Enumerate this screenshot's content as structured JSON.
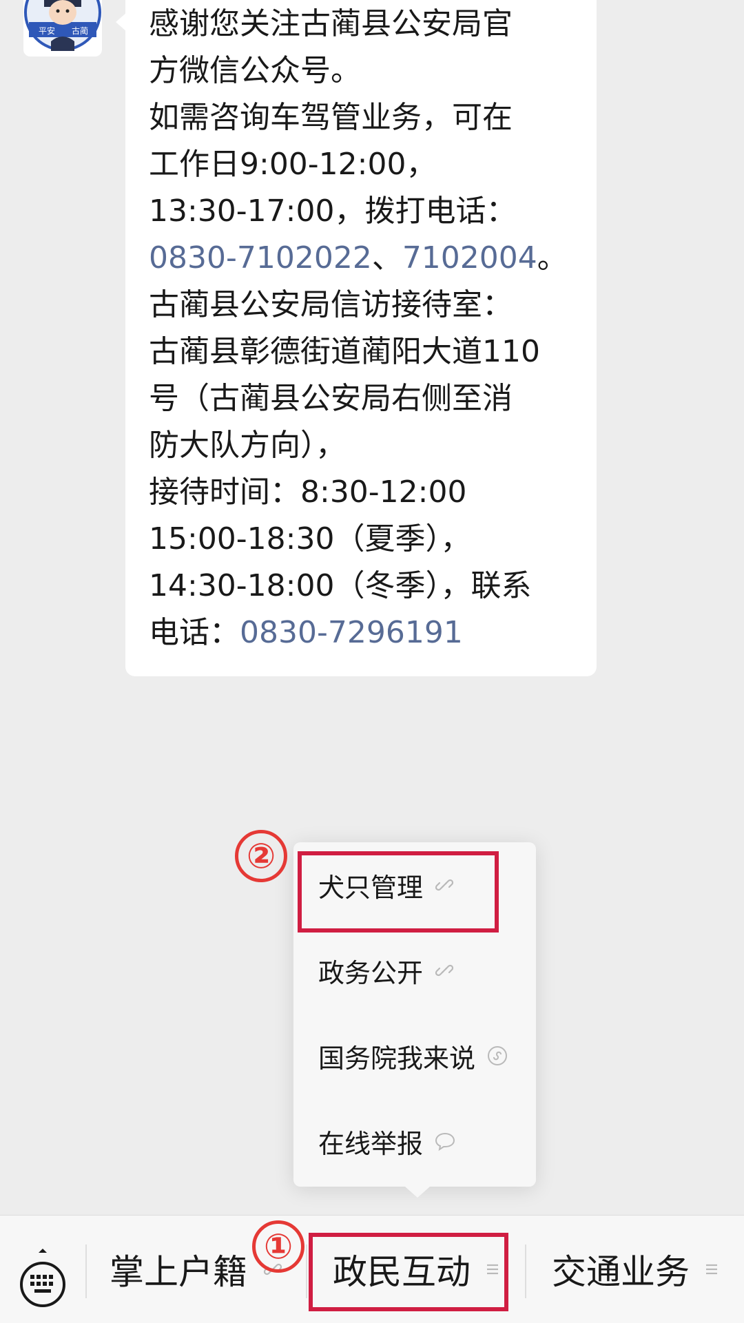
{
  "message": {
    "lines": [
      [
        {
          "text": "感谢您关注古蔺县公安局官",
          "link": false
        }
      ],
      [
        {
          "text": "方微信公众号。",
          "link": false
        }
      ],
      [
        {
          "text": "如需咨询车驾管业务，可在",
          "link": false
        }
      ],
      [
        {
          "text": "工作日9:00-12:00，",
          "link": false
        }
      ],
      [
        {
          "text": "13:30-17:00，拨打电话：",
          "link": false
        }
      ],
      [
        {
          "text": "0830-7102022",
          "link": true
        },
        {
          "text": "、",
          "link": false
        },
        {
          "text": "7102004",
          "link": true
        },
        {
          "text": "。",
          "link": false
        }
      ],
      [
        {
          "text": "古蔺县公安局信访接待室：",
          "link": false
        }
      ],
      [
        {
          "text": "古蔺县彰德街道蔺阳大道110",
          "link": false
        }
      ],
      [
        {
          "text": "号（古蔺县公安局右侧至消",
          "link": false
        }
      ],
      [
        {
          "text": "防大队方向），",
          "link": false
        }
      ],
      [
        {
          "text": "接待时间：8:30-12:00",
          "link": false
        }
      ],
      [
        {
          "text": "15:00-18:30（夏季），",
          "link": false
        }
      ],
      [
        {
          "text": "14:30-18:00（冬季），联系",
          "link": false
        }
      ],
      [
        {
          "text": "电话：",
          "link": false
        },
        {
          "text": "0830-7296191",
          "link": true
        }
      ]
    ]
  },
  "avatar": {
    "text_left": "平安",
    "text_right": "古蔺"
  },
  "submenu": {
    "items": [
      {
        "label": "犬只管理",
        "icon": "link-icon"
      },
      {
        "label": "政务公开",
        "icon": "link-icon"
      },
      {
        "label": "国务院我来说",
        "icon": "mini-program-icon"
      },
      {
        "label": "在线举报",
        "icon": "chat-bubble-icon"
      }
    ]
  },
  "annotations": {
    "step1": "①",
    "step2": "②"
  },
  "bottom_menu": {
    "tabs": [
      {
        "label": "掌上户籍",
        "icon": "link-icon"
      },
      {
        "label": "政民互动",
        "icon": "list-icon"
      },
      {
        "label": "交通业务",
        "icon": "list-icon"
      }
    ]
  },
  "colors": {
    "link": "#576b95",
    "highlight": "#d01e42",
    "annotation": "#e53935"
  }
}
